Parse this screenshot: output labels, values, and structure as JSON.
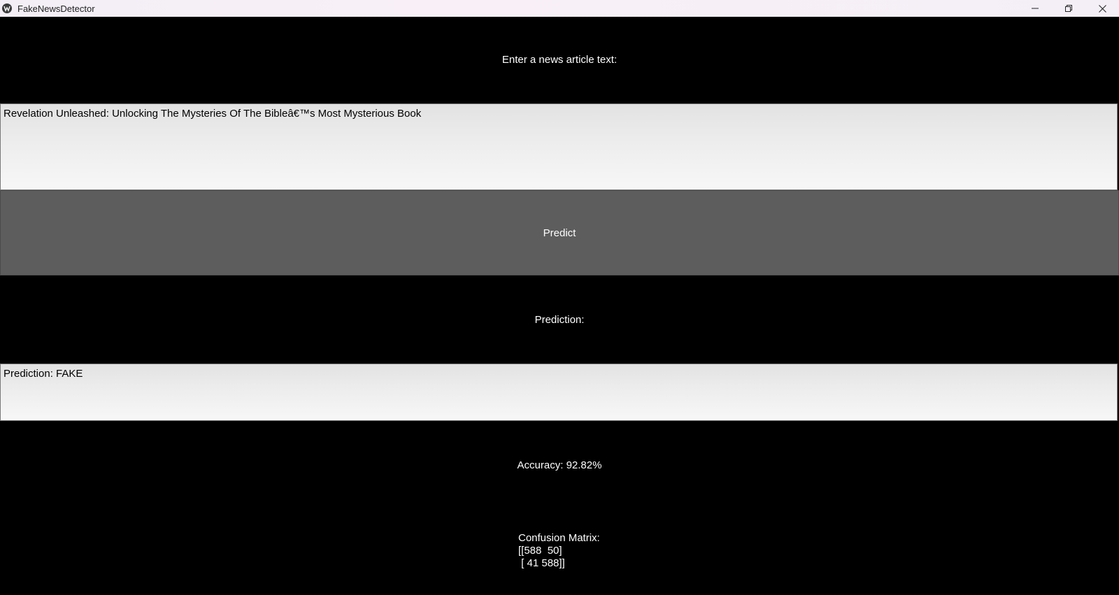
{
  "window": {
    "title": "FakeNewsDetector",
    "minimize_glyph": "–",
    "icons": {
      "app": "app-logo-icon",
      "minimize": "minimize-icon",
      "restore": "restore-icon",
      "close": "close-icon"
    }
  },
  "input": {
    "label": "Enter a news article text:",
    "value": "Revelation Unleashed: Unlocking The Mysteries Of The Bibleâ€™s Most Mysterious Book"
  },
  "predict_button": {
    "label": "Predict"
  },
  "prediction": {
    "label": "Prediction:",
    "value": "Prediction: FAKE"
  },
  "accuracy": {
    "text": "Accuracy: 92.82%"
  },
  "confusion_matrix": {
    "title": "Confusion Matrix:",
    "row1": "[[588  50]",
    "row2": " [ 41 588]]"
  },
  "colors": {
    "background": "#000000",
    "button": "#5d5d5d",
    "text_light": "#ffffff"
  }
}
